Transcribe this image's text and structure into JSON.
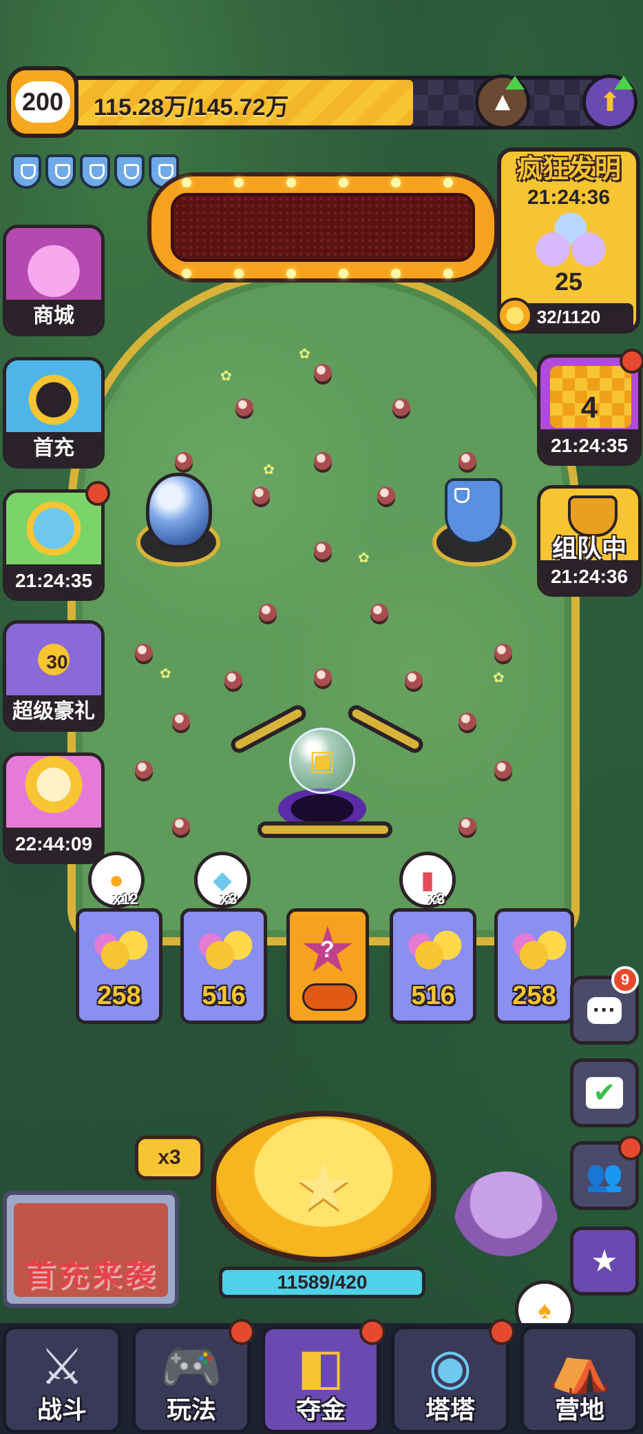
{
  "player": {
    "level": "200",
    "xp_text": "115.28万/145.72万",
    "xp_progress": 0.79
  },
  "left_menu": [
    {
      "label": "商城",
      "icon": "shopping-basket-icon"
    },
    {
      "label": "首充",
      "icon": "shiba-dog-icon"
    },
    {
      "label": "21:24:35",
      "icon": "ticket-icon",
      "has_dot": true
    },
    {
      "label": "超级豪礼",
      "icon": "gift-card-icon",
      "badge": "30"
    },
    {
      "label": "22:44:09",
      "icon": "cupcake-icon"
    }
  ],
  "invention": {
    "title": "疯狂发明",
    "timer": "21:24:36",
    "count": "25",
    "progress": "32/1120"
  },
  "right_menu": [
    {
      "label": "21:24:35",
      "value": "4",
      "icon": "checkered-flag-icon",
      "has_dot": true
    },
    {
      "label": "21:24:36",
      "value": "组队中",
      "icon": "trophy-icon"
    }
  ],
  "bins": [
    {
      "value": "258",
      "multiplier": "x12",
      "mult_icon": "gold-coin-icon"
    },
    {
      "value": "516",
      "multiplier": "x3",
      "mult_icon": "ticket-icon"
    },
    {
      "value": "?",
      "mystery": true
    },
    {
      "value": "516",
      "multiplier": "x3",
      "mult_icon": "battery-icon"
    },
    {
      "value": "258"
    }
  ],
  "side_actions": {
    "chat_badge": "9"
  },
  "controls": {
    "multiplier_label": "x3",
    "energy": "11589/420",
    "promo_text": "首充来袭"
  },
  "bottom_nav": [
    {
      "label": "战斗",
      "icon": "crossed-swords-icon",
      "has_dot": false
    },
    {
      "label": "玩法",
      "icon": "gamepad-icon",
      "has_dot": true
    },
    {
      "label": "夺金",
      "icon": "dice-faces-icon",
      "has_dot": true,
      "active": true
    },
    {
      "label": "塔塔",
      "icon": "robot-cat-icon",
      "has_dot": true
    },
    {
      "label": "营地",
      "icon": "tent-icon",
      "has_dot": false
    }
  ],
  "colors": {
    "accent_gold": "#f7c531",
    "alert_red": "#e64a2e",
    "panel_dark": "#2a2228"
  }
}
